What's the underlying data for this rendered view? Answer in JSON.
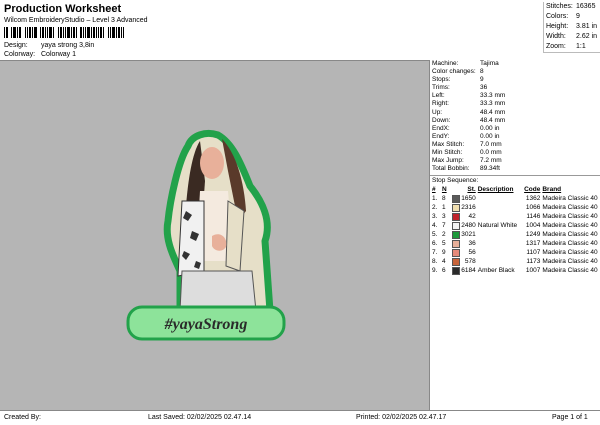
{
  "header": {
    "title": "Production Worksheet",
    "subtitle": "Wilcom EmbroideryStudio – Level 3 Advanced",
    "design_label": "Design:",
    "design_value": "yaya strong 3,8in",
    "colorway_label": "Colorway:",
    "colorway_value": "Colorway 1"
  },
  "top_stats": [
    {
      "label": "Stitches:",
      "value": "16365"
    },
    {
      "label": "Colors:",
      "value": "9"
    },
    {
      "label": "Height:",
      "value": "3.81 in"
    },
    {
      "label": "Width:",
      "value": "2.62 in"
    },
    {
      "label": "Zoom:",
      "value": "1:1"
    }
  ],
  "machine_info": [
    {
      "label": "Machine:",
      "value": "Tajima"
    },
    {
      "label": "Color changes:",
      "value": "8"
    },
    {
      "label": "Stops:",
      "value": "9"
    },
    {
      "label": "Trims:",
      "value": "36"
    },
    {
      "label": "Left:",
      "value": "33.3 mm"
    },
    {
      "label": "Right:",
      "value": "33.3 mm"
    },
    {
      "label": "Up:",
      "value": "48.4 mm"
    },
    {
      "label": "Down:",
      "value": "48.4 mm"
    },
    {
      "label": "EndX:",
      "value": "0.00 in"
    },
    {
      "label": "EndY:",
      "value": "0.00 in"
    },
    {
      "label": "Max Stitch:",
      "value": "7.0 mm"
    },
    {
      "label": "Min Stitch:",
      "value": "0.0 mm"
    },
    {
      "label": "Max Jump:",
      "value": "7.2 mm"
    },
    {
      "label": "Total Bobbin:",
      "value": "89.34ft"
    }
  ],
  "stop_sequence": {
    "title": "Stop Sequence:",
    "headers": [
      "#",
      "N",
      "",
      "St.",
      "Description",
      "Code",
      "Brand"
    ],
    "rows": [
      {
        "num": "1.",
        "n": "8",
        "color": "#5a5a5a",
        "code": "1650",
        "desc": "",
        "stitches": "1362",
        "brand": "Madeira Classic 40"
      },
      {
        "num": "2.",
        "n": "1",
        "color": "#f0dfb0",
        "code": "2316",
        "desc": "",
        "stitches": "1066",
        "brand": "Madeira Classic 40"
      },
      {
        "num": "3.",
        "n": "3",
        "color": "#c0242c",
        "code": "42",
        "desc": "",
        "stitches": "1146",
        "brand": "Madeira Classic 40"
      },
      {
        "num": "4.",
        "n": "7",
        "color": "#f4f4f4",
        "code": "2480",
        "desc": "Natural White",
        "stitches": "1004",
        "brand": "Madeira Classic 40"
      },
      {
        "num": "5.",
        "n": "2",
        "color": "#1e9a3c",
        "code": "3021",
        "desc": "",
        "stitches": "1249",
        "brand": "Madeira Classic 40"
      },
      {
        "num": "6.",
        "n": "5",
        "color": "#e8b09a",
        "code": "36",
        "desc": "",
        "stitches": "1317",
        "brand": "Madeira Classic 40"
      },
      {
        "num": "7.",
        "n": "9",
        "color": "#e58a7a",
        "code": "56",
        "desc": "",
        "stitches": "1107",
        "brand": "Madeira Classic 40"
      },
      {
        "num": "8.",
        "n": "4",
        "color": "#c8643a",
        "code": "578",
        "desc": "",
        "stitches": "1173",
        "brand": "Madeira Classic 40"
      },
      {
        "num": "9.",
        "n": "6",
        "color": "#2a2a2a",
        "code": "6184",
        "desc": "Amber Black",
        "stitches": "1007",
        "brand": "Madeira Classic 40"
      }
    ]
  },
  "design_preview": {
    "caption": "#yayaStrong"
  },
  "footer": {
    "created_by": "Created By:",
    "last_saved": "Last Saved: 02/02/2025 02.47.14",
    "printed": "Printed: 02/02/2025 02.47.17",
    "page": "Page 1 of 1"
  }
}
